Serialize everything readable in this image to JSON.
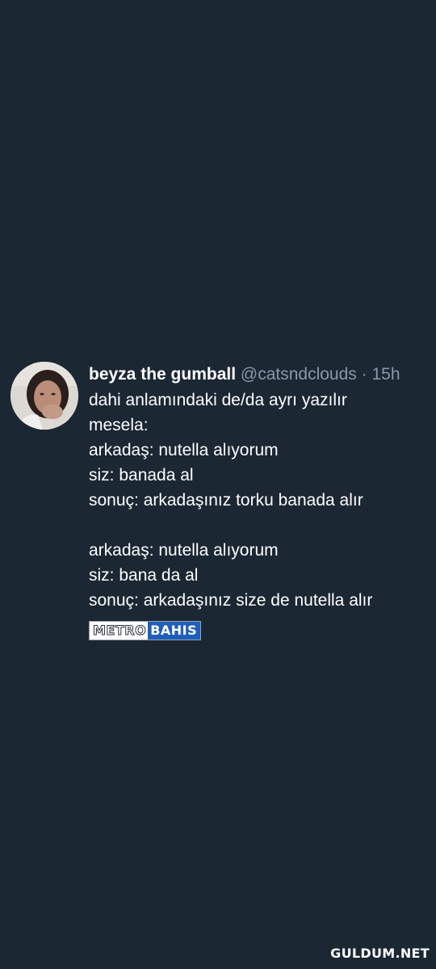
{
  "tweet": {
    "display_name": "beyza the gumball",
    "handle": "@catsndclouds",
    "separator": "·",
    "time": "15h",
    "lines": [
      "dahi anlamındaki de/da ayrı yazılır",
      "mesela:",
      "arkadaş: nutella alıyorum",
      "siz: banada al",
      "sonuç: arkadaşınız torku banada alır",
      "",
      "arkadaş: nutella alıyorum",
      "siz: bana da al",
      "sonuç: arkadaşınız size de nutella alır"
    ],
    "brand_part1": "METRO",
    "brand_part2": "BAHIS"
  },
  "watermark": "GULDUM.NET",
  "colors": {
    "background": "#1b2733",
    "text": "#ffffff",
    "muted": "#8899a6",
    "brand_blue": "#1d5fb8"
  }
}
